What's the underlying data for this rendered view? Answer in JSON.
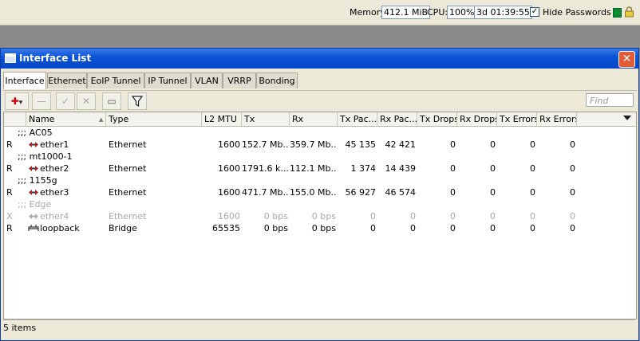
{
  "topbar": {
    "memory_label": "Memory:",
    "memory_value": "412.1 MiB",
    "cpu_label": "CPU:",
    "cpu_value": "100%",
    "uptime": "3d 01:39:55",
    "hide_passwords_label": "Hide Passwords",
    "hide_passwords_checked": "✓",
    "status_color": "#0c8a2d"
  },
  "window": {
    "title": "Interface List",
    "close_symbol": "✕",
    "tabs": [
      "Interface",
      "Ethernet",
      "EoIP Tunnel",
      "IP Tunnel",
      "VLAN",
      "VRRP",
      "Bonding"
    ],
    "active_tab": "Interface",
    "toolbar": {
      "add": "✚",
      "add_arrow": "▾",
      "remove": "—",
      "enable": "✓",
      "disable": "✕",
      "comment": "▭",
      "filter": "Y",
      "find_placeholder": "Find"
    },
    "columns": [
      "Name",
      "Type",
      "L2 MTU",
      "Tx",
      "Rx",
      "Tx Pac...",
      "Rx Pac...",
      "Tx Drops",
      "Rx Drops",
      "Tx Errors",
      "Rx Errors"
    ],
    "comments": [
      ";;; AC05",
      ";;; mt1000-1",
      ";;; 1155g",
      ";;; Edge"
    ],
    "rows": [
      {
        "flag": "R",
        "name": "ether1",
        "type": "Ethernet",
        "l2mtu": "1600",
        "tx": "152.7 Mb...",
        "rx": "359.7 Mb...",
        "txpac": "45 135",
        "rxpac": "42 421",
        "txdrops": "0",
        "rxdrops": "0",
        "txerr": "0",
        "rxerr": "0"
      },
      {
        "flag": "R",
        "name": "ether2",
        "type": "Ethernet",
        "l2mtu": "1600",
        "tx": "1791.6 k...",
        "rx": "112.1 Mb...",
        "txpac": "1 374",
        "rxpac": "14 439",
        "txdrops": "0",
        "rxdrops": "0",
        "txerr": "0",
        "rxerr": "0"
      },
      {
        "flag": "R",
        "name": "ether3",
        "type": "Ethernet",
        "l2mtu": "1600",
        "tx": "471.7 Mb...",
        "rx": "155.0 Mb...",
        "txpac": "56 927",
        "rxpac": "46 574",
        "txdrops": "0",
        "rxdrops": "0",
        "txerr": "0",
        "rxerr": "0"
      },
      {
        "flag": "X",
        "name": "ether4",
        "type": "Ethernet",
        "l2mtu": "1600",
        "tx": "0 bps",
        "rx": "0 bps",
        "txpac": "0",
        "rxpac": "0",
        "txdrops": "0",
        "rxdrops": "0",
        "txerr": "0",
        "rxerr": "0"
      },
      {
        "flag": "R",
        "name": "loopback",
        "type": "Bridge",
        "l2mtu": "65535",
        "tx": "0 bps",
        "rx": "0 bps",
        "txpac": "0",
        "rxpac": "0",
        "txdrops": "0",
        "rxdrops": "0",
        "txerr": "0",
        "rxerr": "0"
      }
    ],
    "status": "5 items"
  }
}
